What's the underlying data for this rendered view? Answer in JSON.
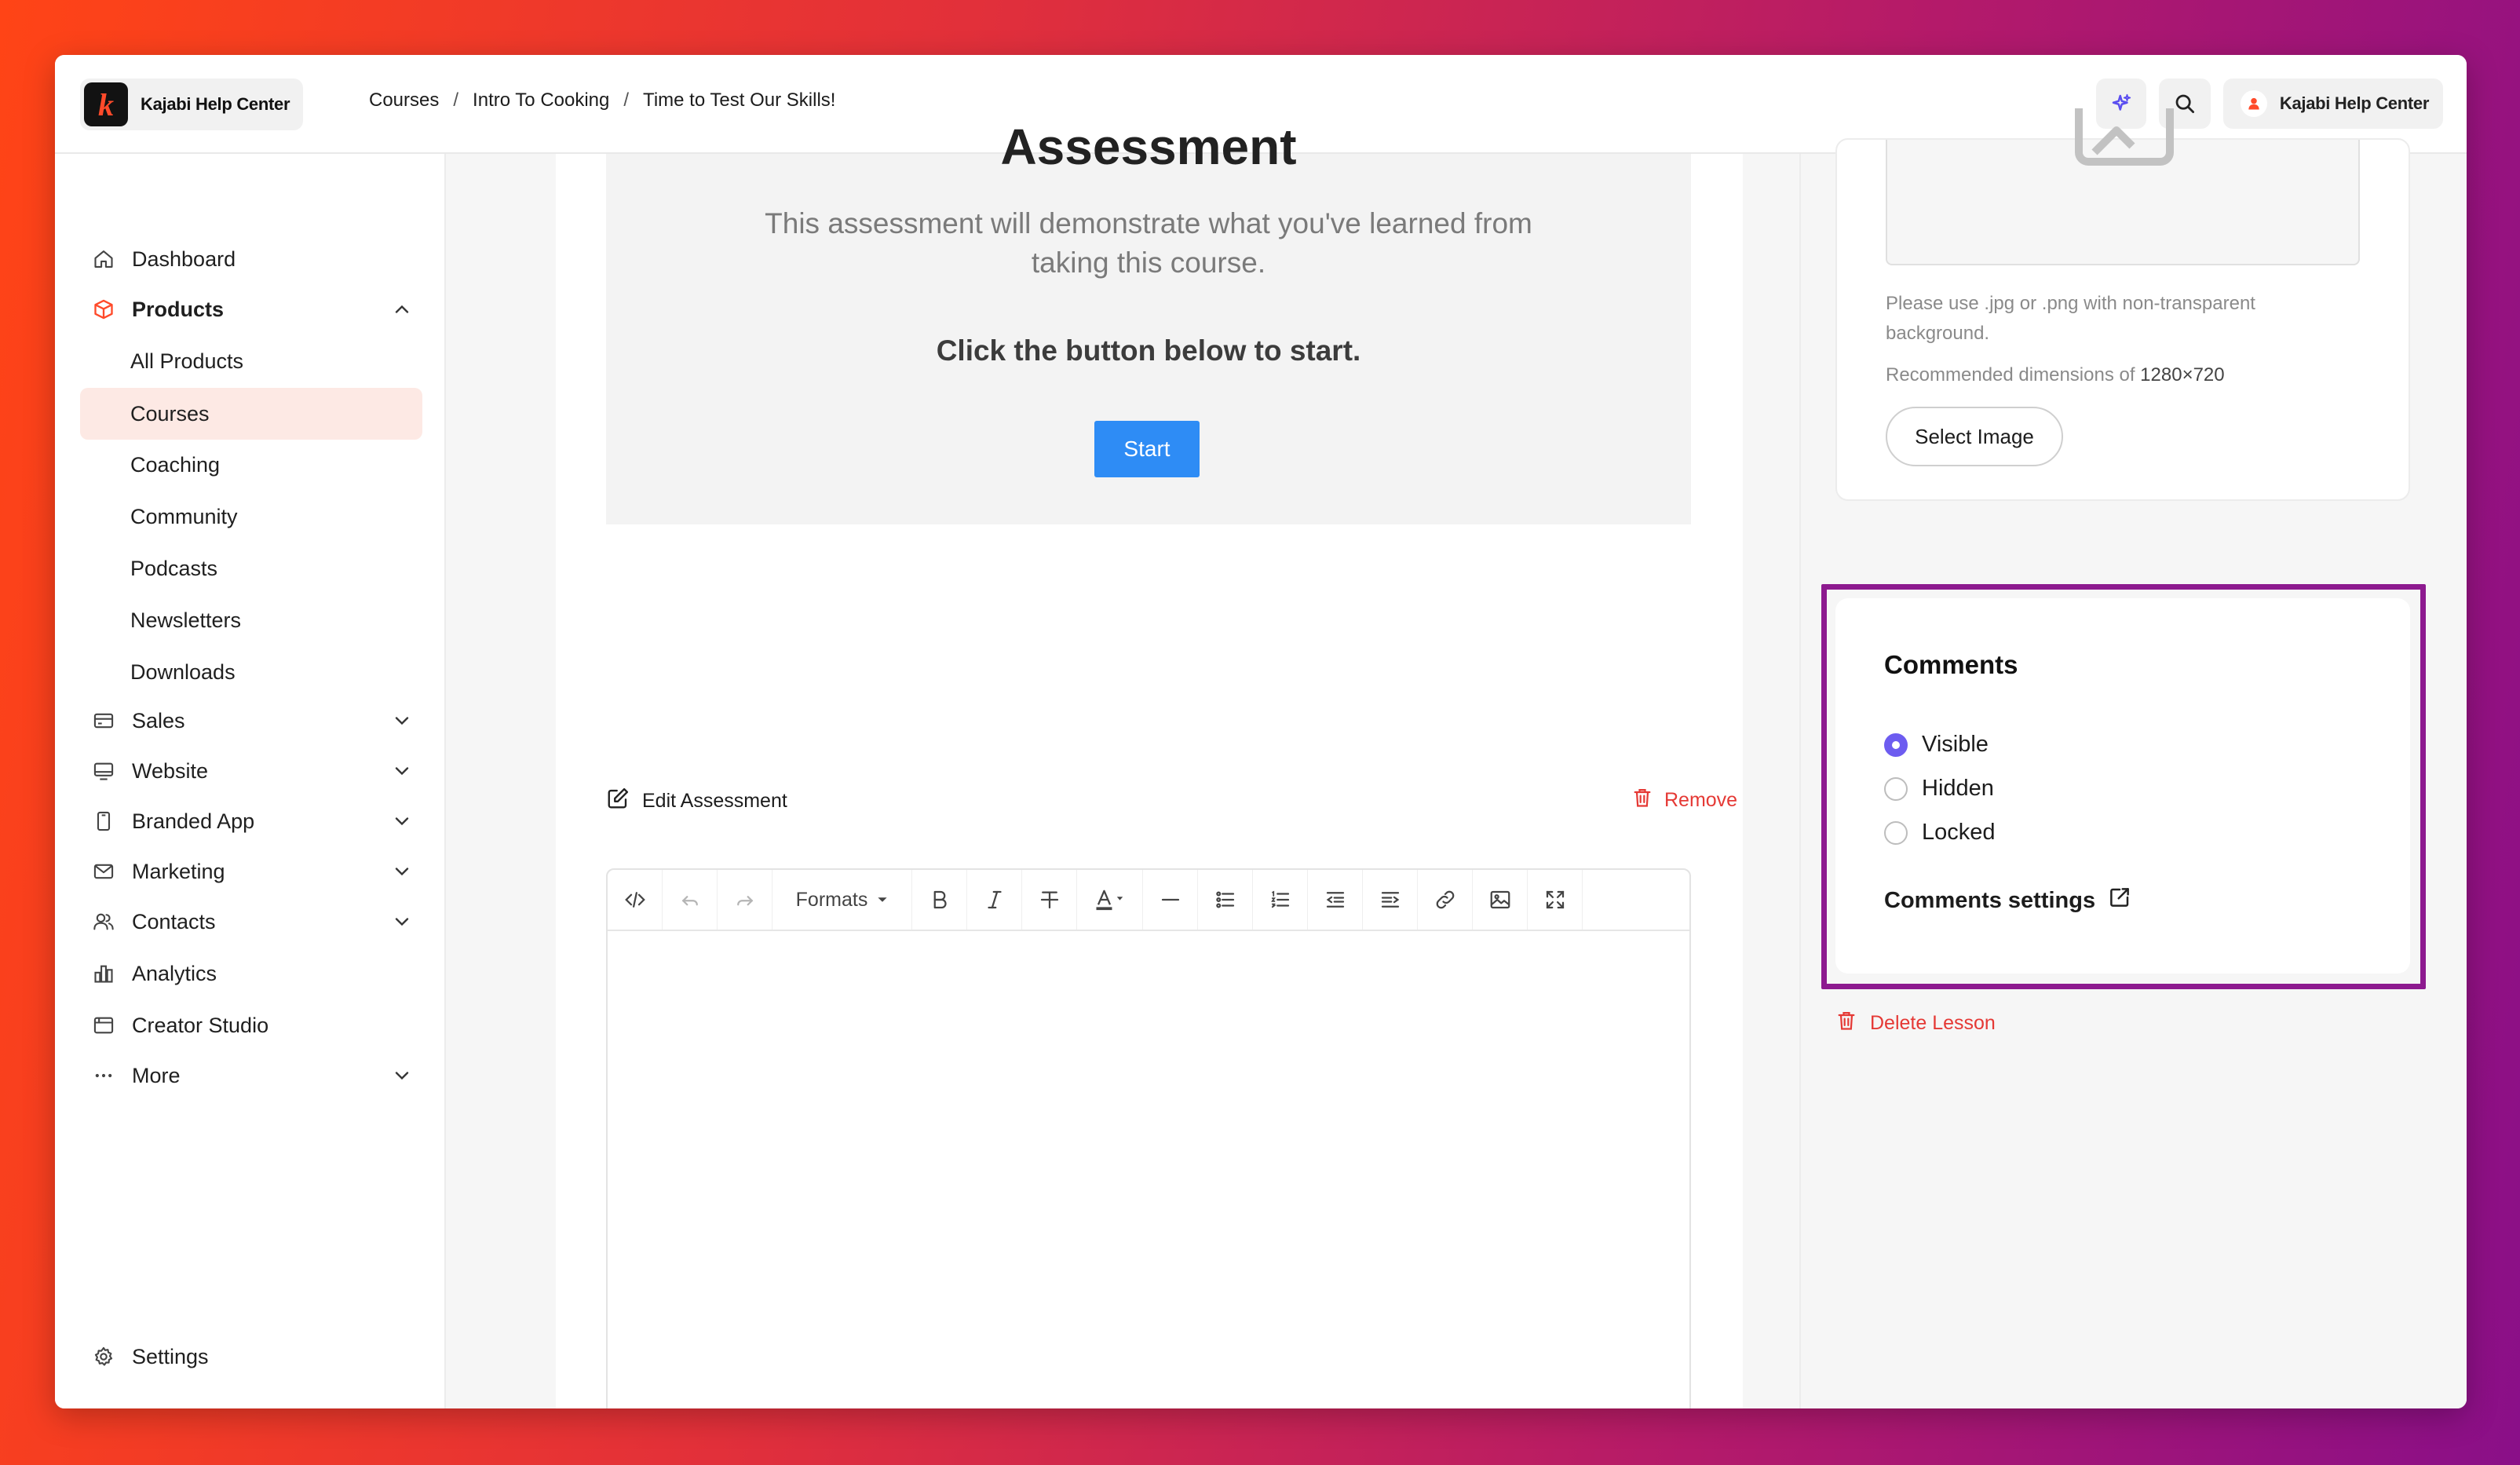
{
  "brand": {
    "name": "Kajabi Help Center",
    "logo_letter": "k"
  },
  "breadcrumb": [
    "Courses",
    "Intro To Cooking",
    "Time to Test Our Skills!"
  ],
  "breadcrumb_sep": "/",
  "user": {
    "name": "Kajabi Help Center"
  },
  "sidebar": {
    "items": [
      {
        "label": "Dashboard",
        "icon": "home-icon"
      },
      {
        "label": "Products",
        "icon": "box-icon",
        "expanded": true
      },
      {
        "label": "All Products"
      },
      {
        "label": "Courses",
        "active": true
      },
      {
        "label": "Coaching"
      },
      {
        "label": "Community"
      },
      {
        "label": "Podcasts"
      },
      {
        "label": "Newsletters"
      },
      {
        "label": "Downloads"
      },
      {
        "label": "Sales",
        "icon": "card-icon"
      },
      {
        "label": "Website",
        "icon": "monitor-icon"
      },
      {
        "label": "Branded App",
        "icon": "phone-icon"
      },
      {
        "label": "Marketing",
        "icon": "mail-icon"
      },
      {
        "label": "Contacts",
        "icon": "people-icon"
      },
      {
        "label": "Analytics",
        "icon": "chart-icon"
      },
      {
        "label": "Creator Studio",
        "icon": "calendar-icon"
      },
      {
        "label": "More",
        "icon": "dots-icon"
      }
    ],
    "settings_label": "Settings"
  },
  "assessment": {
    "title": "Assessment",
    "description": "This assessment will demonstrate what you've learned from taking this course.",
    "cta": "Click the button below to start.",
    "start_label": "Start",
    "edit_label": "Edit Assessment",
    "remove_label": "Remove"
  },
  "editor": {
    "formats_label": "Formats"
  },
  "image_panel": {
    "hint": "Please use .jpg or .png with non-transparent background.",
    "dim_prefix": "Recommended dimensions of",
    "dim_value": "1280×720",
    "select_label": "Select Image"
  },
  "comments": {
    "title": "Comments",
    "options": [
      {
        "label": "Visible",
        "selected": true
      },
      {
        "label": "Hidden",
        "selected": false
      },
      {
        "label": "Locked",
        "selected": false
      }
    ],
    "settings_label": "Comments settings"
  },
  "delete_lesson_label": "Delete Lesson",
  "colors": {
    "accent": "#6d5cf0",
    "danger": "#e53935",
    "primary_button": "#2e8cf5",
    "highlight": "#8d1a8f",
    "active_nav": "#fde9e4"
  }
}
